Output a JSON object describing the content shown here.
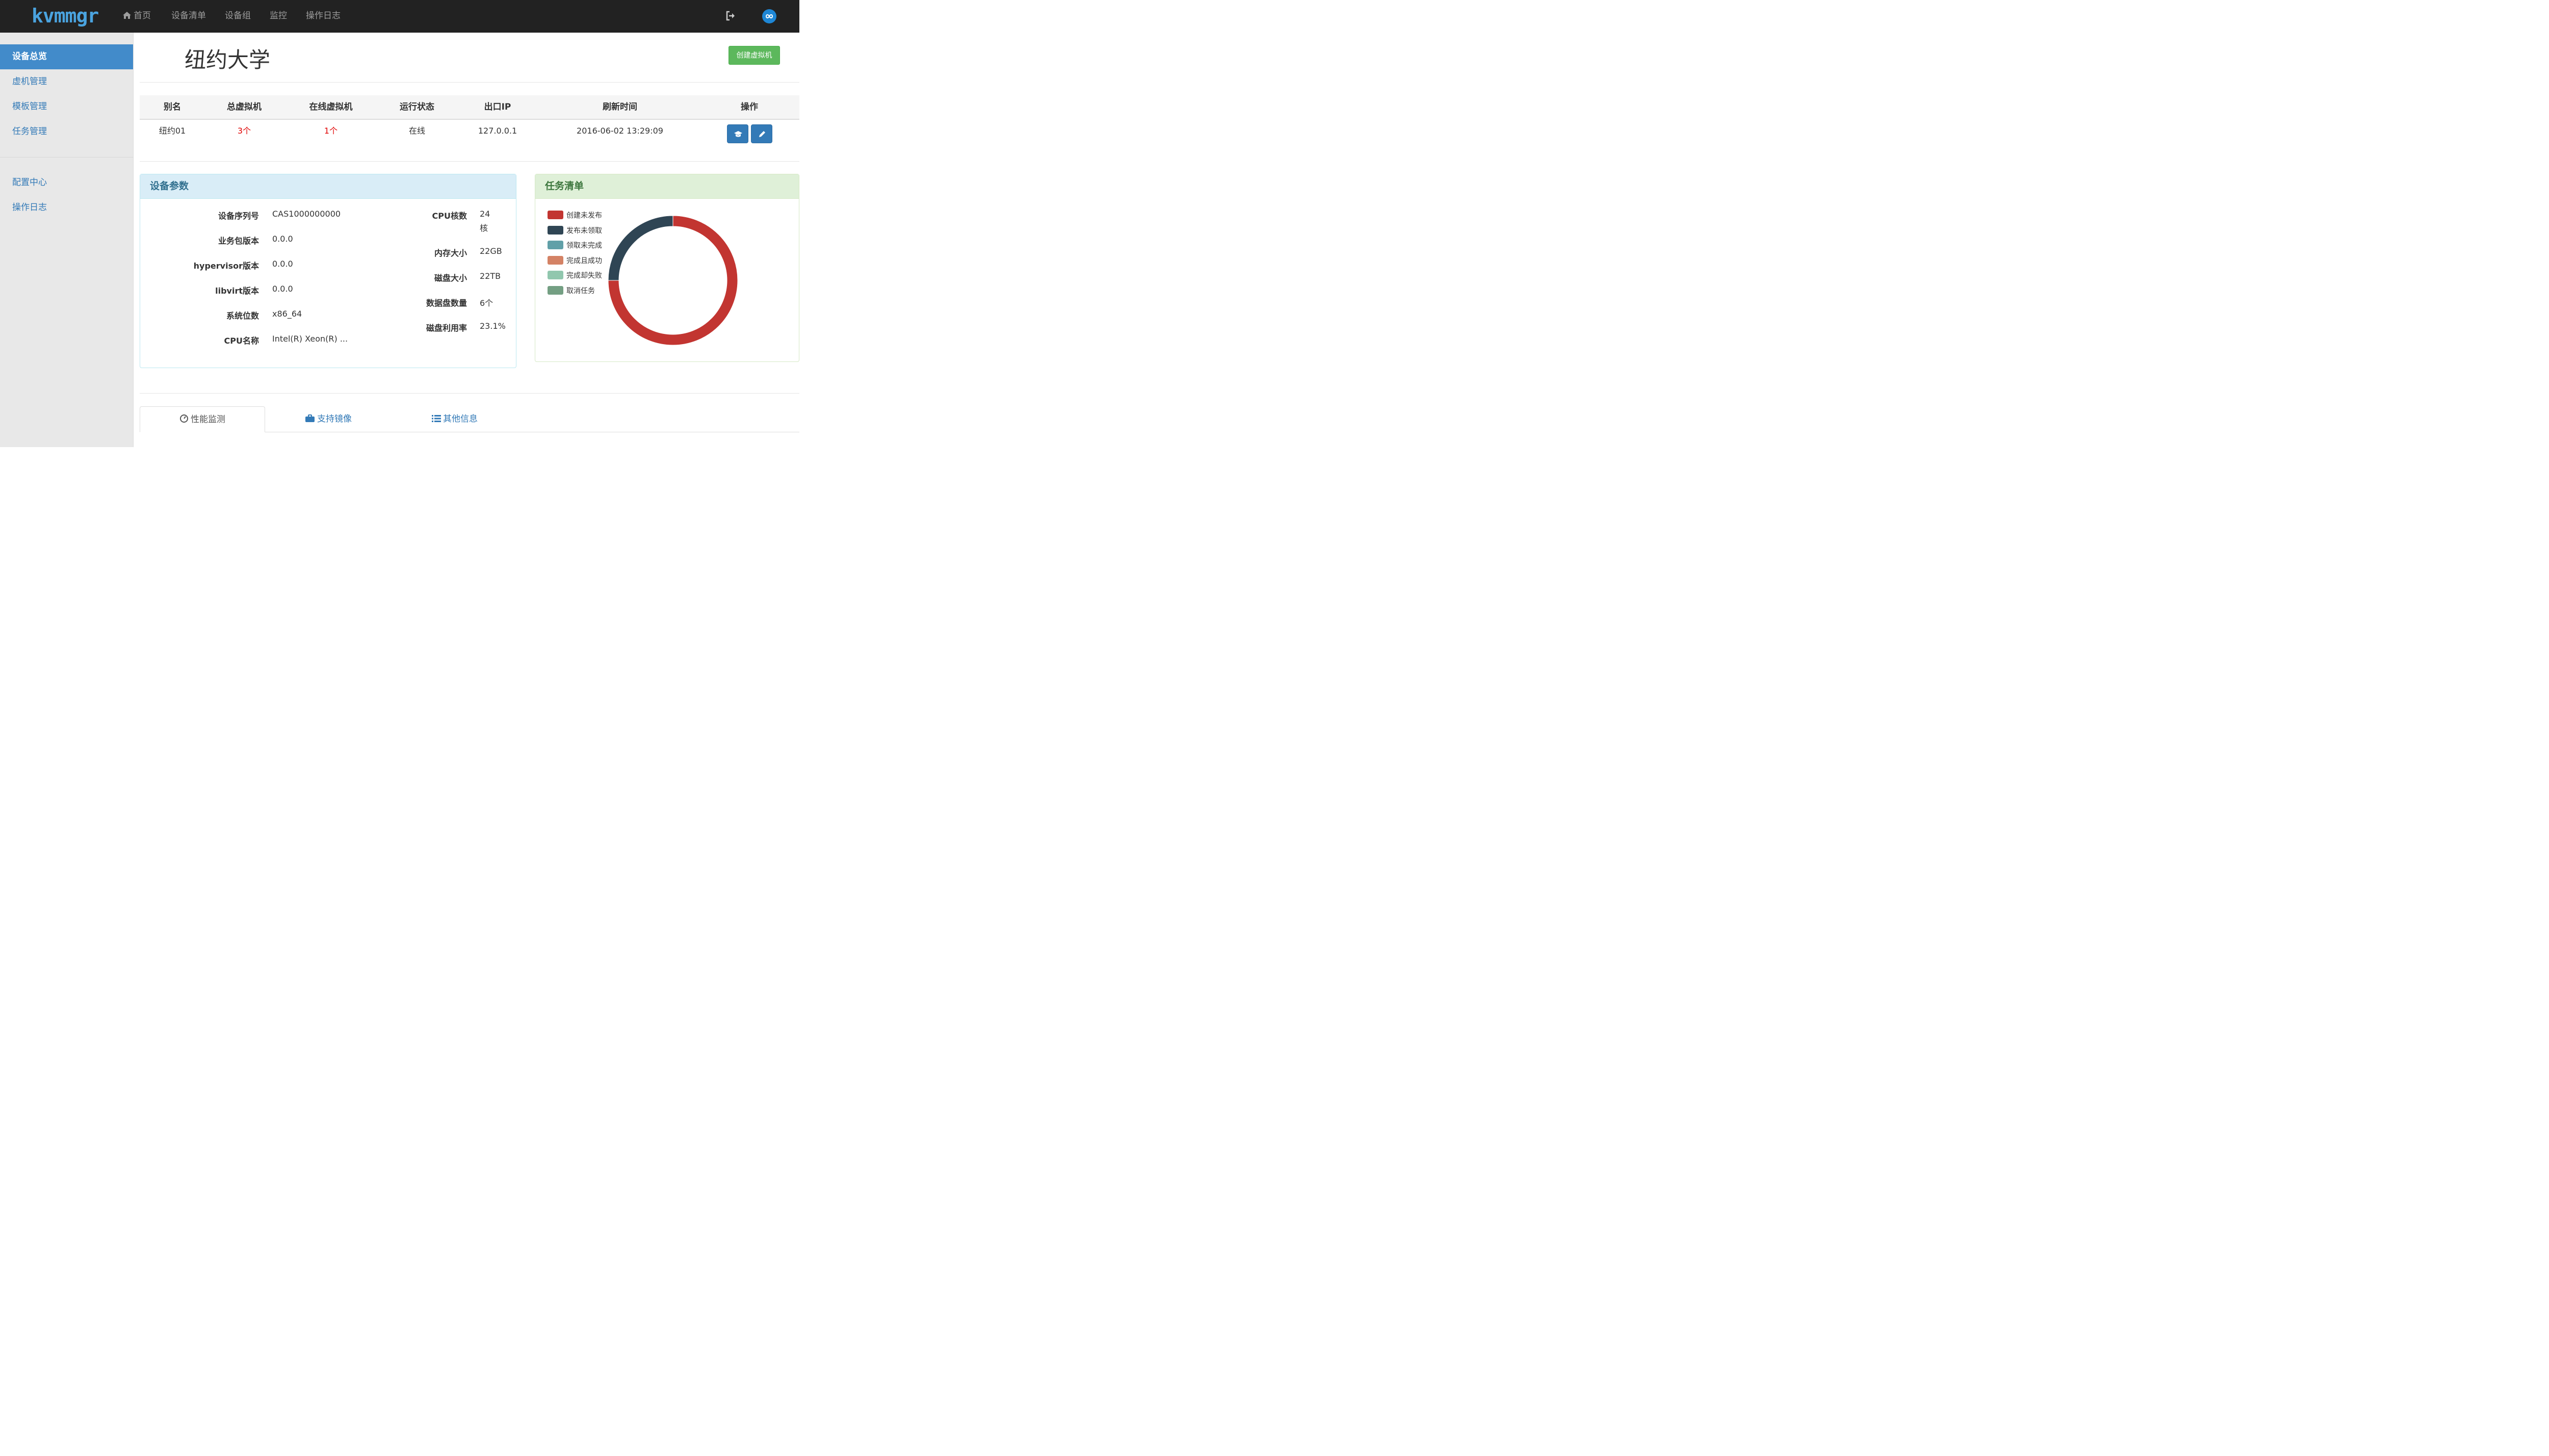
{
  "navbar": {
    "logo": "kvmmgr",
    "items": [
      "首页",
      "设备清单",
      "设备组",
      "监控",
      "操作日志"
    ],
    "icons": [
      "home-icon",
      "logout-icon",
      "avatar-icon"
    ]
  },
  "sidebar": {
    "items": [
      "设备总览",
      "虚机管理",
      "模板管理",
      "任务管理"
    ],
    "items2": [
      "配置中心",
      "操作日志"
    ],
    "active": "设备总览"
  },
  "page": {
    "title": "纽约大学",
    "create_button": "创建虚拟机"
  },
  "table": {
    "headers": [
      "别名",
      "总虚拟机",
      "在线虚拟机",
      "运行状态",
      "出口IP",
      "刷新时间",
      "操作"
    ],
    "row": {
      "alias": "纽约01",
      "total_vm": "3个",
      "online_vm": "1个",
      "status": "在线",
      "ip": "127.0.0.1",
      "refresh_time": "2016-06-02 13:29:09"
    },
    "action_icons": [
      "graduation-cap-icon",
      "pencil-icon"
    ]
  },
  "params": {
    "title": "设备参数",
    "left": [
      {
        "label": "设备序列号",
        "value": "CAS1000000000"
      },
      {
        "label": "业务包版本",
        "value": "0.0.0"
      },
      {
        "label": "hypervisor版本",
        "value": "0.0.0"
      },
      {
        "label": "libvirt版本",
        "value": "0.0.0"
      },
      {
        "label": "系统位数",
        "value": "x86_64"
      },
      {
        "label": "CPU名称",
        "value": "Intel(R) Xeon(R) ..."
      }
    ],
    "right": [
      {
        "label": "CPU核数",
        "value": "24",
        "value2": "核"
      },
      {
        "label": "内存大小",
        "value": "22GB"
      },
      {
        "label": "磁盘大小",
        "value": "22TB"
      },
      {
        "label": "数据盘数量",
        "value": "6个"
      },
      {
        "label": "磁盘利用率",
        "value": "23.1%"
      }
    ]
  },
  "tasks": {
    "title": "任务清单",
    "legend": [
      "创建未发布",
      "发布未领取",
      "领取未完成",
      "完成且成功",
      "完成却失败",
      "取消任务"
    ],
    "colors": [
      "#c23531",
      "#2f4554",
      "#61a0a8",
      "#d48265",
      "#91c7ae",
      "#749f83"
    ]
  },
  "chart_data": {
    "type": "pie",
    "categories": [
      "创建未发布",
      "发布未领取",
      "领取未完成",
      "完成且成功",
      "完成却失败",
      "取消任务"
    ],
    "values": [
      3,
      1,
      0,
      0,
      0,
      0
    ],
    "donut": true,
    "legend_position": "left"
  },
  "tabs": [
    "性能监测",
    "支持镜像",
    "其他信息"
  ]
}
